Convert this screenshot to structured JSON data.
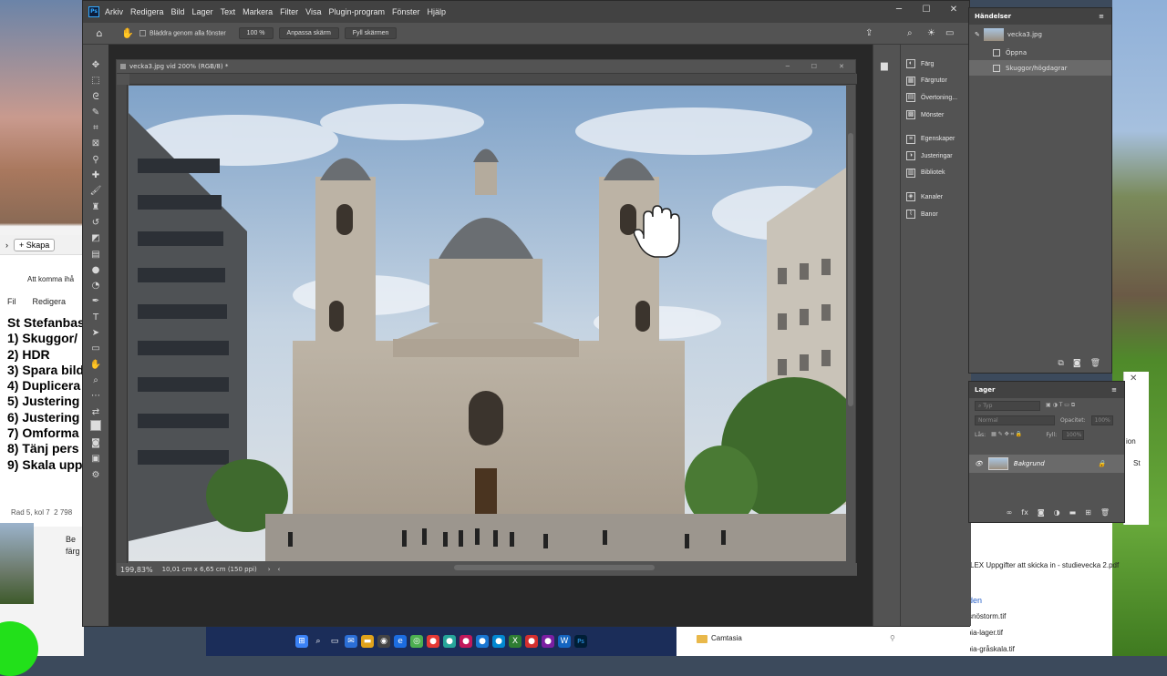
{
  "word": {
    "skapa": "Skapa",
    "doc_tab": "Att komma ihå",
    "menu": [
      "Fil",
      "Redigera"
    ],
    "lines": [
      "St Stefanbas",
      "1) Skuggor/",
      "2) HDR",
      "3) Spara bild",
      "4) Duplicera",
      "5) Justering",
      "6) Justering",
      "7) Omforma",
      "8) Tänj pers",
      "9) Skala upp"
    ],
    "status": "Rad 5, kol 7",
    "status2": "2 798",
    "thumb_caption": [
      "Be",
      "färg"
    ]
  },
  "ps": {
    "menu": [
      "Arkiv",
      "Redigera",
      "Bild",
      "Lager",
      "Text",
      "Markera",
      "Filter",
      "Visa",
      "Plugin-program",
      "Fönster",
      "Hjälp"
    ],
    "options": {
      "scroll_all": "Bläddra genom alla fönster",
      "zoom": "100 %",
      "fit": "Anpassa skärm",
      "fill": "Fyll skärmen"
    },
    "doc_title": "vecka3.jpg vid 200% (RGB/8) *",
    "zoom_status": "199,83%",
    "doc_size": "10,01 cm x 6,65 cm (150 ppi)",
    "panel_items": [
      {
        "label": "Färg",
        "icon": "color-icon"
      },
      {
        "label": "Färgrutor",
        "icon": "swatches-icon"
      },
      {
        "label": "Övertoning...",
        "icon": "gradient-icon"
      },
      {
        "label": "Mönster",
        "icon": "pattern-icon"
      },
      {
        "label": "Egenskaper",
        "icon": "properties-icon"
      },
      {
        "label": "Justeringar",
        "icon": "adjustments-icon"
      },
      {
        "label": "Bibliotek",
        "icon": "libraries-icon"
      },
      {
        "label": "Kanaler",
        "icon": "channels-icon"
      },
      {
        "label": "Banor",
        "icon": "paths-icon"
      }
    ]
  },
  "history": {
    "title": "Händelser",
    "snapshot": "vecka3.jpg",
    "items": [
      "Öppna",
      "Skuggor/högdagrar"
    ]
  },
  "layers": {
    "title": "Lager",
    "search": "Typ",
    "blend": "Normal",
    "opacity_label": "Opacitet:",
    "opacity": "100%",
    "lock_label": "Lås:",
    "fill_label": "Fyll:",
    "fill": "100%",
    "layer_name": "Bakgrund"
  },
  "explorer": {
    "pdf": "LEX  Uppgifter att skicka in - studievecka 2.pdf",
    "heading": "den",
    "files": [
      "snöstorm.tif",
      "blommor-sepia-lager.tif",
      "blommor-sepia-gråskala.tif"
    ],
    "side_label": "ion",
    "side_st": "St"
  },
  "taskbar": {
    "camtasia": "Camtasia"
  }
}
